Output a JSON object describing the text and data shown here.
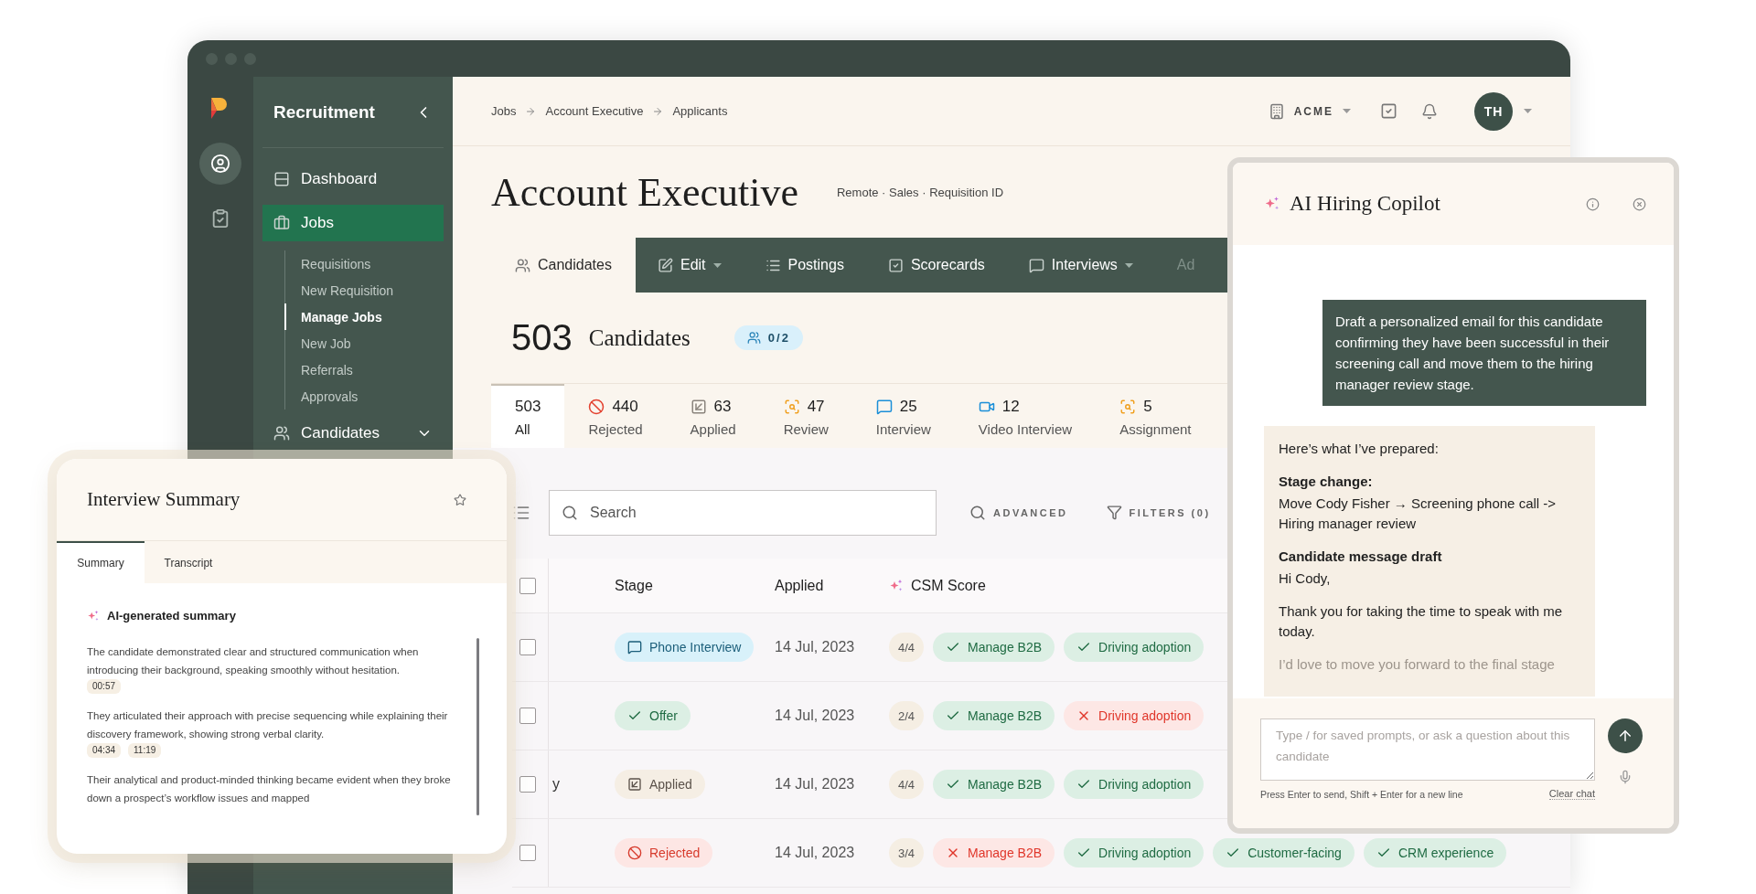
{
  "rail": {
    "items": [
      {
        "kind": "profile",
        "selected": true
      },
      {
        "kind": "clipboard",
        "selected": false
      }
    ]
  },
  "sidebar": {
    "title": "Recruitment",
    "items": [
      {
        "label": "Dashboard",
        "kind": "link",
        "selected": false
      },
      {
        "label": "Jobs",
        "kind": "section",
        "selected": true,
        "expanded": true,
        "children": [
          {
            "label": "Requisitions",
            "selected": false
          },
          {
            "label": "New Requisition",
            "selected": false
          },
          {
            "label": "Manage Jobs",
            "selected": true
          },
          {
            "label": "New Job",
            "selected": false
          },
          {
            "label": "Referrals",
            "selected": false
          },
          {
            "label": "Approvals",
            "selected": false
          }
        ]
      },
      {
        "label": "Candidates",
        "kind": "menu",
        "selected": false,
        "expanded": false
      }
    ]
  },
  "header": {
    "breadcrumbs": [
      "Jobs",
      "Account Executive",
      "Applicants"
    ],
    "org": "ACME",
    "avatar": "TH"
  },
  "job": {
    "title": "Account Executive",
    "meta": "Remote · Sales · Requisition ID"
  },
  "tabs": [
    {
      "label": "Candidates",
      "kind": "candidates",
      "dropdown": false,
      "selected": true
    },
    {
      "label": "Edit",
      "kind": "edit",
      "dropdown": true,
      "selected": false
    },
    {
      "label": "Postings",
      "kind": "postings",
      "dropdown": false,
      "selected": false
    },
    {
      "label": "Scorecards",
      "kind": "scorecards",
      "dropdown": false,
      "selected": false
    },
    {
      "label": "Interviews",
      "kind": "interviews",
      "dropdown": true,
      "selected": false
    },
    {
      "label": "Ad",
      "kind": "cut",
      "dropdown": false,
      "selected": false
    }
  ],
  "summary": {
    "count": "503",
    "label": "Candidates",
    "badge": "0/2"
  },
  "stage_filters": [
    {
      "count": "503",
      "label": "All",
      "kind": "all",
      "selected": true
    },
    {
      "count": "440",
      "label": "Rejected",
      "kind": "rejected",
      "selected": false
    },
    {
      "count": "63",
      "label": "Applied",
      "kind": "applied",
      "selected": false
    },
    {
      "count": "47",
      "label": "Review",
      "kind": "review",
      "selected": false
    },
    {
      "count": "25",
      "label": "Interview",
      "kind": "interview",
      "selected": false
    },
    {
      "count": "12",
      "label": "Video Interview",
      "kind": "video",
      "selected": false
    },
    {
      "count": "5",
      "label": "Assignment",
      "kind": "assignment",
      "selected": false
    }
  ],
  "toolbar": {
    "search_placeholder": "Search",
    "advanced": "ADVANCED",
    "filters": "FILTERS (0)"
  },
  "table": {
    "header_checked": false,
    "columns": [
      "Stage",
      "Applied",
      "CSM Score"
    ],
    "rows": [
      {
        "checked": false,
        "stage": {
          "label": "Phone Interview",
          "kind": "phone_interview"
        },
        "applied": "14 Jul, 2023",
        "score": "4/4",
        "skills": [
          {
            "label": "Manage B2B",
            "met": true
          },
          {
            "label": "Driving adoption",
            "met": true
          }
        ]
      },
      {
        "checked": false,
        "stage": {
          "label": "Offer",
          "kind": "offer"
        },
        "applied": "14 Jul, 2023",
        "score": "2/4",
        "skills": [
          {
            "label": "Manage B2B",
            "met": true
          },
          {
            "label": "Driving adoption",
            "met": false
          }
        ]
      },
      {
        "checked": false,
        "name": "y",
        "stage": {
          "label": "Applied",
          "kind": "applied"
        },
        "applied": "14 Jul, 2023",
        "score": "4/4",
        "skills": [
          {
            "label": "Manage B2B",
            "met": true
          },
          {
            "label": "Driving adoption",
            "met": true
          }
        ]
      },
      {
        "checked": false,
        "stage": {
          "label": "Rejected",
          "kind": "rejected"
        },
        "applied": "14 Jul, 2023",
        "score": "3/4",
        "skills": [
          {
            "label": "Manage B2B",
            "met": false
          },
          {
            "label": "Driving adoption",
            "met": true
          },
          {
            "label": "Customer-facing",
            "met": true
          },
          {
            "label": "CRM experience",
            "met": true
          }
        ]
      }
    ]
  },
  "interview_summary": {
    "title": "Interview Summary",
    "tabs": [
      {
        "label": "Summary",
        "selected": true
      },
      {
        "label": "Transcript",
        "selected": false
      }
    ],
    "heading": "AI-generated summary",
    "paragraphs": [
      {
        "text": "The candidate demonstrated clear and structured communication when introducing their background, speaking smoothly without hesitation.",
        "timestamps": [
          "00:57"
        ]
      },
      {
        "text": "They articulated their approach with precise sequencing while explaining their discovery framework, showing strong verbal clarity.",
        "timestamps": [
          "04:34",
          "11:19"
        ]
      },
      {
        "text": "Their analytical and product-minded thinking became evident when they broke down a prospect’s workflow issues and mapped"
      }
    ]
  },
  "copilot": {
    "title": "AI Hiring Copilot",
    "user_message": "Draft a personalized email for this candidate confirming they have been successful in their screening call  and move them to the hiring manager review stage.",
    "reply": [
      {
        "kind": "text",
        "text": "Here’s what I’ve prepared:"
      },
      {
        "kind": "heading",
        "text": "Stage change:"
      },
      {
        "kind": "text",
        "text": "Move Cody Fisher → Screening phone call -> Hiring manager review"
      },
      {
        "kind": "heading",
        "text": "Candidate message draft"
      },
      {
        "kind": "text",
        "text": "Hi Cody,"
      },
      {
        "kind": "text",
        "text": "Thank you for taking the time to speak with me today."
      },
      {
        "kind": "faded",
        "text": "I’d love to move you forward to the final stage"
      }
    ],
    "input_placeholder": "Type / for saved prompts, or ask a question about this candidate",
    "hint": "Press Enter to send, Shift + Enter for a new line",
    "clear": "Clear chat"
  }
}
